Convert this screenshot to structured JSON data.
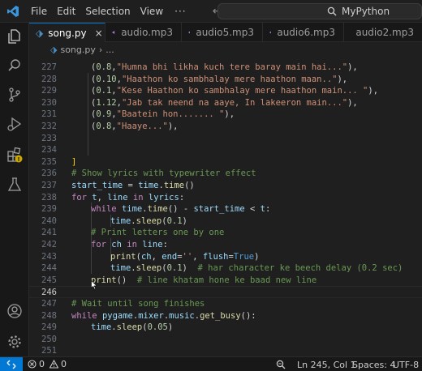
{
  "titlebar": {
    "menu": [
      "File",
      "Edit",
      "Selection",
      "View"
    ],
    "more": "···",
    "search_text": "MyPython"
  },
  "activitybar": {
    "icons": [
      "explorer-icon",
      "search-icon",
      "source-control-icon",
      "run-debug-icon",
      "extensions-icon",
      "testing-icon",
      "account-icon",
      "manage-gear-icon"
    ]
  },
  "tabs": [
    {
      "label": "song.py",
      "active": true,
      "icon": "python-file-icon"
    },
    {
      "label": "audio.mp3",
      "active": false,
      "icon": "audio-file-icon"
    },
    {
      "label": "audio5.mp3",
      "active": false,
      "icon": "audio-file-icon"
    },
    {
      "label": "audio6.mp3",
      "active": false,
      "icon": "audio-file-icon"
    },
    {
      "label": "audio2.mp3",
      "active": false,
      "icon": "audio-file-icon"
    }
  ],
  "tab_close_glyph": "×",
  "breadcrumb": {
    "file": "song.py",
    "more": "..."
  },
  "editor": {
    "line_numbers": [
      "227",
      "228",
      "229",
      "230",
      "231",
      "232",
      "233",
      "234",
      "235",
      "236",
      "237",
      "238",
      "239",
      "240",
      "241",
      "242",
      "243",
      "244",
      "245",
      "246",
      "247",
      "248",
      "249",
      "250",
      "251"
    ],
    "current_line": "245"
  },
  "statusbar": {
    "errors": "0",
    "warnings": "0",
    "position": "Ln 245, Col 1",
    "spaces": "Spaces: 4",
    "encoding": "UTF-8"
  },
  "colors": {
    "accent": "#0078d4",
    "keyword": "#c586c0",
    "function": "#dcdcaa",
    "variable": "#9cdcfe",
    "number": "#b5cea8",
    "string": "#ce9178",
    "comment": "#6a9955",
    "builtin_true": "#569cd6",
    "warning_badge": "#cca700"
  }
}
